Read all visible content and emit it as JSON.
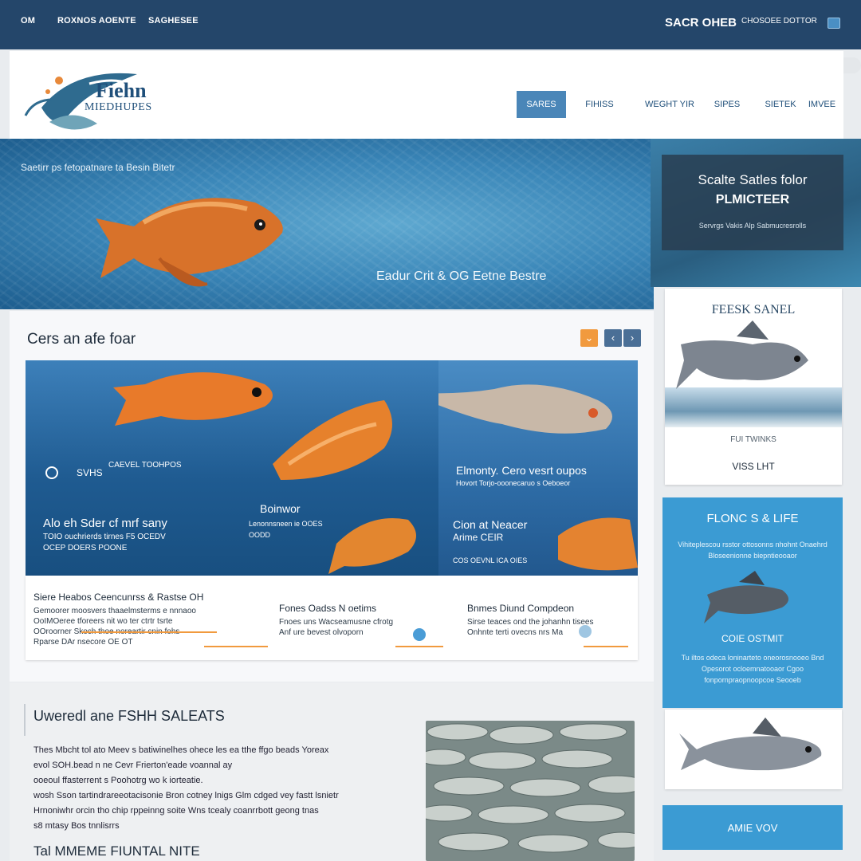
{
  "topbar": {
    "links": [
      "OM",
      "ROXNOS AOENTE",
      "SAGHESEE"
    ],
    "brand": "SACR OHEB",
    "phone": "CHOSOEE DOTTOR",
    "cart_icon": "cart-icon"
  },
  "header": {
    "logo_line1": "Fiehn",
    "logo_line2": "MIEDHUPES",
    "nav": [
      "SARES",
      "FIHISS",
      "WEGHT YIR",
      "SIPES",
      "SIETEK",
      "IMVEE"
    ]
  },
  "hero": {
    "caption": "Saetirr ps fetopatnare ta Besin Bitetr",
    "tagline": "Eadur Crit & OG Eetne Bestre",
    "promo_line1": "Scalte Satles folor",
    "promo_line2": "PLMICTEER",
    "promo_line3": "Servrgs Vakis Alp Sabmucresrolls"
  },
  "section": {
    "title": "Cers an afe foar",
    "controls": [
      "⌄",
      "‹",
      "›"
    ],
    "feature_left": {
      "tag": "SVHS",
      "tag2": "CAEVEL TOOHPOS",
      "heading": "Alo eh Sder cf mrf sany",
      "line1": "TOIO ouchrierds tirnes F5 OCEDV",
      "line2": "OCEP DOERS POONE",
      "sub_heading": "Boinwor",
      "sub_line1": "Lenonnsneen ie OOES",
      "sub_line2": "OODD"
    },
    "feature_right": {
      "heading": "Elmonty. Cero vesrt oupos",
      "line1": "Hovort Torjo-ooonecaruo s Oeboeor",
      "heading2": "Cion at Neacer",
      "line2": "Arime CEIR",
      "line3": "COS OEVNL ICA OIES"
    }
  },
  "cards": [
    {
      "title": "Siere Heabos Ceencunrss & Rastse OH",
      "desc": "Gemoorer moosvers thaaelmsterms e nnnaoo\nOoIMOeree tforeers nit wo ter ctrtr tsrte\nOOroorner Skoch thoe noreartir cnin fohs\nRparse DAr nsecore OE OT"
    },
    {
      "title": "Fones Oadss N oetims",
      "desc": "Fnoes uns Wacseamusne cfrotg\nAnf ure bevest olvoporn"
    },
    {
      "title": "Bnmes Diund Compdeon",
      "desc": "Sirse teaces ond the johanhn tisees\nOnhnte terti ovecns nrs Ma"
    }
  ],
  "article": {
    "title": "Uweredl ane FSHH SALEATS",
    "lines": [
      "Thes Mbcht tol ato Meev s batiwinelhes ohece les ea tthe ffgo beads Yoreax",
      "evol SOH.bead n ne Cevr Frierton'eade voannal ay",
      "ooeoul ffasterrent s Poohotrg wo k iorteatie.",
      "wosh Sson tartindrareeotacisonie Bron cotney lnigs Glm cdged vey fastt lsnietr",
      "Hrnoniwhr orcin tho chip rppeinng soite Wns tcealy coanrrbott geong tnas",
      "s8 mtasy Bos tnnlisrrs"
    ],
    "footer": "Tal MMEME FIUNTAL NITE"
  },
  "sidebar": {
    "card1_title": "FEESK SANEL",
    "card1_sub": "FUI TWINKS",
    "card1_cta": "VISS LHT",
    "panel_title": "FLONC S & LIFE",
    "panel_text": "Vihiteplescou rsstor ottosonns nhohnt Onaehrd Bloseenionne biepntieooaor",
    "panel_sub": "COIE OSTMIT",
    "panel_text2": "Tu iltos odeca loninarteto oneorosnooeo Bnd Opesorot ocloemnatooaor Cgoo fonpornpraopnoopcoe Seooeb",
    "button": "AMIE VOV"
  },
  "colors": {
    "topbar": "#24466a",
    "accent_blue": "#3b9bd3",
    "nav_active": "#4a86b8",
    "accent_orange": "#f19a3e"
  }
}
